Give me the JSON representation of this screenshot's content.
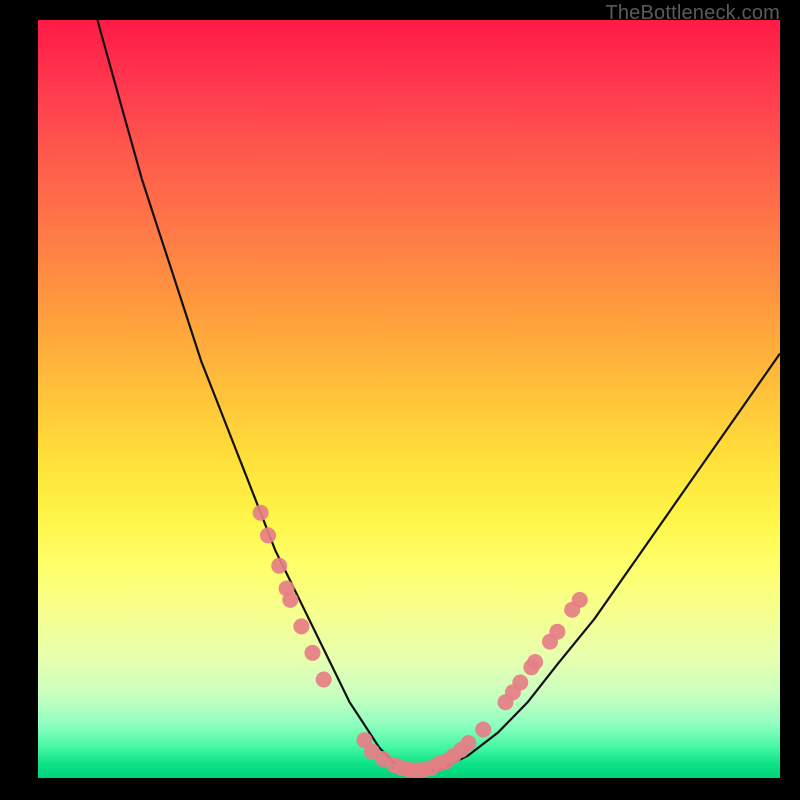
{
  "attribution": "TheBottleneck.com",
  "colors": {
    "frame": "#000000",
    "curve": "#111111",
    "marker": "#e67e86"
  },
  "chart_data": {
    "type": "line",
    "title": "",
    "xlabel": "",
    "ylabel": "",
    "xlim": [
      0,
      100
    ],
    "ylim": [
      0,
      100
    ],
    "note": "No axis tick labels are visible; values are estimated from pixel positions as percentage of plot area (y=0 bottom, x=0 left).",
    "series": [
      {
        "name": "bottleneck-curve",
        "x": [
          8,
          10,
          12,
          14,
          16,
          18,
          20,
          22,
          24,
          26,
          28,
          30,
          32,
          34,
          36,
          38,
          40,
          42,
          44,
          46,
          48,
          50,
          54,
          58,
          62,
          66,
          70,
          75,
          80,
          85,
          90,
          95,
          100
        ],
        "y": [
          100,
          93,
          86,
          79,
          73,
          67,
          61,
          55,
          50,
          45,
          40,
          35,
          30,
          26,
          22,
          18,
          14,
          10,
          7,
          4,
          2,
          1,
          1,
          3,
          6,
          10,
          15,
          21,
          28,
          35,
          42,
          49,
          56
        ]
      }
    ],
    "markers": {
      "name": "highlighted-points",
      "points": [
        {
          "x": 30,
          "y": 35
        },
        {
          "x": 31,
          "y": 32
        },
        {
          "x": 32.5,
          "y": 28
        },
        {
          "x": 33.5,
          "y": 25
        },
        {
          "x": 34,
          "y": 23.5
        },
        {
          "x": 35.5,
          "y": 20
        },
        {
          "x": 37,
          "y": 16.5
        },
        {
          "x": 38.5,
          "y": 13
        },
        {
          "x": 44,
          "y": 5
        },
        {
          "x": 45,
          "y": 3.5
        },
        {
          "x": 46.5,
          "y": 2.5
        },
        {
          "x": 48,
          "y": 1.7
        },
        {
          "x": 49,
          "y": 1.3
        },
        {
          "x": 50,
          "y": 1.1
        },
        {
          "x": 51,
          "y": 1.0
        },
        {
          "x": 52,
          "y": 1.1
        },
        {
          "x": 53,
          "y": 1.3
        },
        {
          "x": 54,
          "y": 1.9
        },
        {
          "x": 55,
          "y": 2.2
        },
        {
          "x": 56,
          "y": 2.9
        },
        {
          "x": 57,
          "y": 3.7
        },
        {
          "x": 58,
          "y": 4.6
        },
        {
          "x": 60,
          "y": 6.4
        },
        {
          "x": 63,
          "y": 10
        },
        {
          "x": 64,
          "y": 11.3
        },
        {
          "x": 65,
          "y": 12.6
        },
        {
          "x": 66.5,
          "y": 14.6
        },
        {
          "x": 67,
          "y": 15.3
        },
        {
          "x": 69,
          "y": 18.0
        },
        {
          "x": 70,
          "y": 19.3
        },
        {
          "x": 72,
          "y": 22.2
        },
        {
          "x": 73,
          "y": 23.5
        }
      ]
    }
  }
}
